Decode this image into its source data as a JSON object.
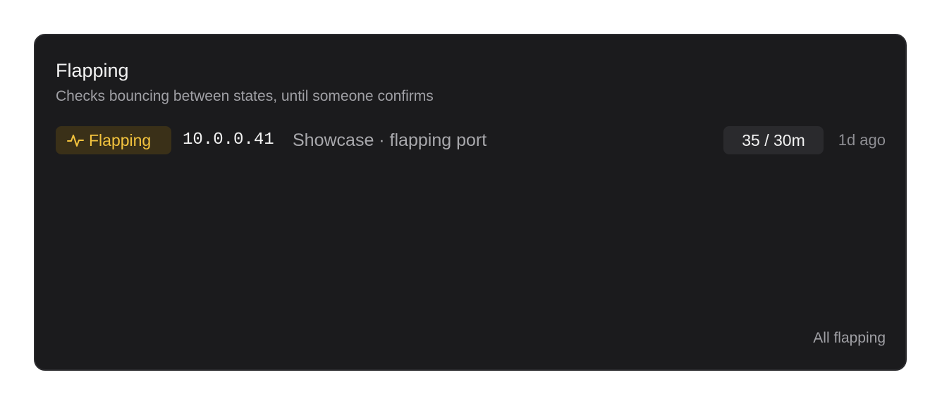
{
  "card": {
    "title": "Flapping",
    "subtitle": "Checks bouncing between states, until someone confirms"
  },
  "rows": [
    {
      "status": "Flapping",
      "status_icon": "activity-pulse-icon",
      "status_color": "#f3c33e",
      "host": "10.0.0.41",
      "description": "Showcase · flapping port",
      "count": "35 / 30m",
      "time_ago": "1d ago"
    }
  ],
  "footer": {
    "link_label": "All flapping"
  },
  "colors": {
    "card_bg": "#1b1b1d",
    "badge_bg": "#3a3018",
    "accent": "#f3c33e"
  }
}
